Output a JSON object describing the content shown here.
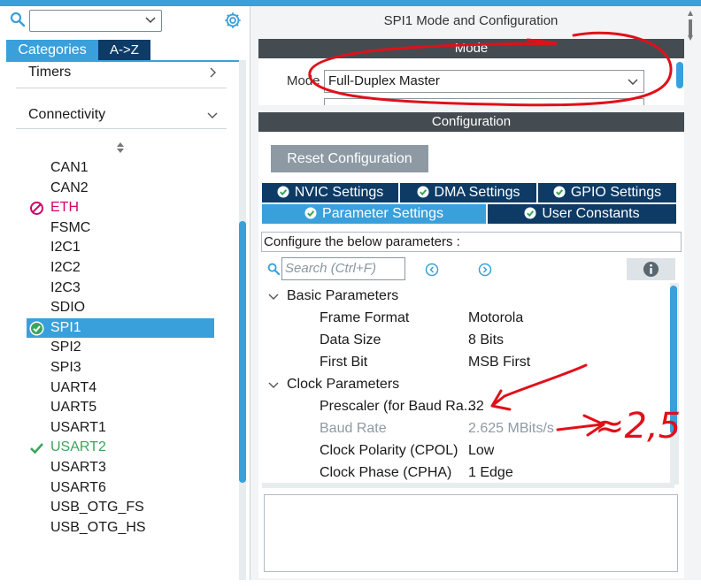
{
  "left_panel": {
    "tabs": {
      "categories": "Categories",
      "az": "A->Z"
    },
    "categories": [
      {
        "label": "Timers"
      },
      {
        "label": "Connectivity"
      }
    ],
    "items": [
      {
        "label": "CAN1",
        "state": "normal"
      },
      {
        "label": "CAN2",
        "state": "normal"
      },
      {
        "label": "ETH",
        "state": "error"
      },
      {
        "label": "FSMC",
        "state": "normal"
      },
      {
        "label": "I2C1",
        "state": "normal"
      },
      {
        "label": "I2C2",
        "state": "normal"
      },
      {
        "label": "I2C3",
        "state": "normal"
      },
      {
        "label": "SDIO",
        "state": "normal"
      },
      {
        "label": "SPI1",
        "state": "selected"
      },
      {
        "label": "SPI2",
        "state": "normal"
      },
      {
        "label": "SPI3",
        "state": "normal"
      },
      {
        "label": "UART4",
        "state": "normal"
      },
      {
        "label": "UART5",
        "state": "normal"
      },
      {
        "label": "USART1",
        "state": "normal"
      },
      {
        "label": "USART2",
        "state": "ok"
      },
      {
        "label": "USART3",
        "state": "normal"
      },
      {
        "label": "USART6",
        "state": "normal"
      },
      {
        "label": "USB_OTG_FS",
        "state": "normal"
      },
      {
        "label": "USB_OTG_HS",
        "state": "normal"
      }
    ]
  },
  "right_panel": {
    "title": "SPI1 Mode and Configuration",
    "mode_header": "Mode",
    "mode_label": "Mode",
    "mode_value": "Full-Duplex Master",
    "config_header": "Configuration",
    "reset_button": "Reset Configuration",
    "tabs_row1": [
      "NVIC Settings",
      "DMA Settings",
      "GPIO Settings"
    ],
    "tabs_row2": [
      "Parameter Settings",
      "User Constants"
    ],
    "configure_label": "Configure the below parameters :",
    "search_placeholder": "Search (Ctrl+F)",
    "groups": [
      {
        "label": "Basic Parameters",
        "params": [
          {
            "name": "Frame Format",
            "value": "Motorola",
            "disabled": false
          },
          {
            "name": "Data Size",
            "value": "8 Bits",
            "disabled": false
          },
          {
            "name": "First Bit",
            "value": "MSB First",
            "disabled": false
          }
        ]
      },
      {
        "label": "Clock Parameters",
        "params": [
          {
            "name": "Prescaler (for Baud Ra...",
            "value": "32",
            "disabled": false
          },
          {
            "name": "Baud Rate",
            "value": "2.625 MBits/s",
            "disabled": true
          },
          {
            "name": "Clock Polarity (CPOL)",
            "value": "Low",
            "disabled": false
          },
          {
            "name": "Clock Phase (CPHA)",
            "value": "1 Edge",
            "disabled": false
          }
        ]
      }
    ]
  },
  "annotation": {
    "handwritten_text": "≈2,5",
    "ink_color": "#e0101a"
  },
  "colors": {
    "accent": "#39a0dc",
    "dark_tab": "#0d3b66",
    "section_bar": "#444c52",
    "error": "#d4006c",
    "ok": "#3ba55c"
  }
}
